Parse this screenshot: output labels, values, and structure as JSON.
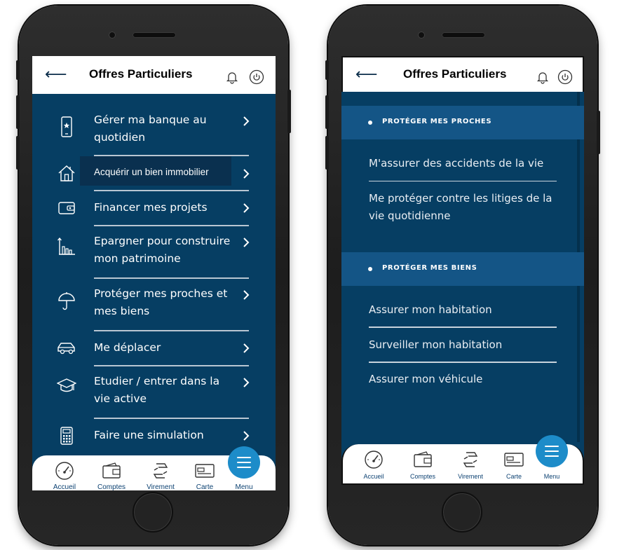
{
  "phone_left": {
    "header": {
      "back_icon": "arrow-left-icon",
      "title": "Offres Particuliers",
      "bell_icon": "bell-icon",
      "power_icon": "power-icon"
    },
    "menu": [
      {
        "icon": "smartphone-icon",
        "label": "Gérer ma banque au quotidien"
      },
      {
        "icon": "house-icon",
        "label": "Acquérir un bien immobilier",
        "highlighted": true
      },
      {
        "icon": "wallet-icon",
        "label": "Financer mes projets"
      },
      {
        "icon": "bar-chart-icon",
        "label": "Epargner pour construire mon patrimoine"
      },
      {
        "icon": "umbrella-icon",
        "label": "Protéger mes proches et mes biens"
      },
      {
        "icon": "car-icon",
        "label": "Me déplacer"
      },
      {
        "icon": "graduation-cap-icon",
        "label": "Etudier / entrer dans la vie active"
      },
      {
        "icon": "calculator-icon",
        "label": "Faire une simulation"
      }
    ]
  },
  "phone_right": {
    "header": {
      "back_icon": "arrow-left-icon",
      "title": "Offres Particuliers",
      "bell_icon": "bell-icon",
      "power_icon": "power-icon"
    },
    "sections": [
      {
        "title": "PROTÉGER MES PROCHES",
        "items": [
          "M'assurer des accidents de la vie",
          "Me protéger contre les litiges de la vie quotidienne"
        ]
      },
      {
        "title": "PROTÉGER MES BIENS",
        "items": [
          "Assurer mon habitation",
          "Surveiller mon habitation",
          "Assurer mon véhicule"
        ]
      }
    ]
  },
  "bottom_nav": {
    "items": [
      {
        "icon": "speedometer-icon",
        "label": "Accueil"
      },
      {
        "icon": "wallet-icon",
        "label": "Comptes"
      },
      {
        "icon": "transfer-icon",
        "label": "Virement"
      },
      {
        "icon": "card-icon",
        "label": "Carte"
      },
      {
        "icon": "menu-icon",
        "label": "Menu"
      }
    ]
  },
  "colors": {
    "background": "#063e63",
    "section_header": "#145586",
    "accent": "#1d8cc9",
    "nav_text": "#0d4272"
  }
}
